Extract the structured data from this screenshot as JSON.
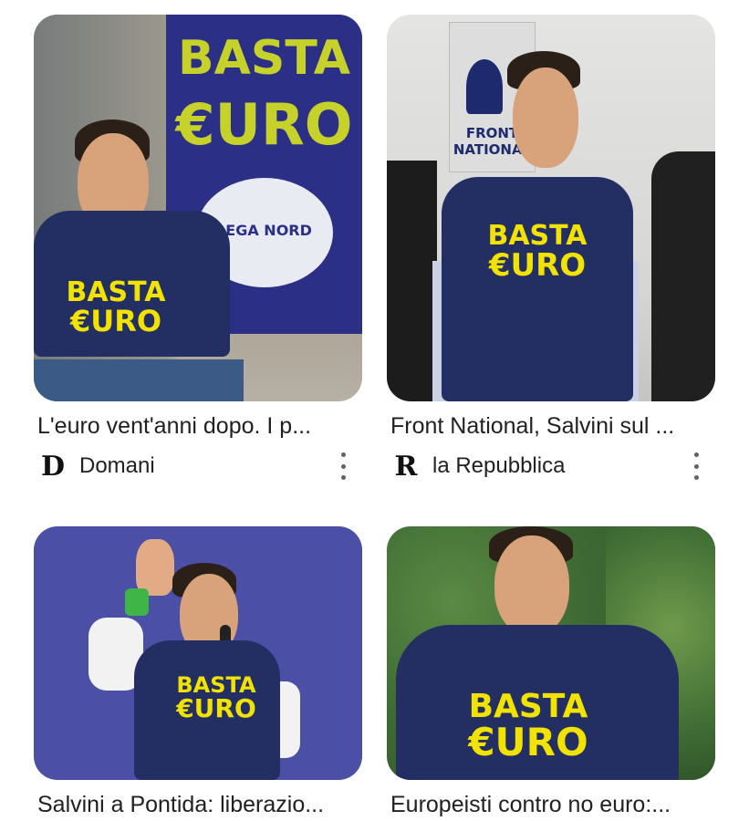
{
  "results": [
    {
      "caption": "L'euro vent'anni dopo. I p...",
      "source_logo": "D",
      "source": "Domani",
      "slogan_line1": "BASTA",
      "slogan_line2": "€URO",
      "poster_line1": "BASTA",
      "poster_line2": "€URO",
      "poster_badge": "LEGA NORD"
    },
    {
      "caption": "Front National, Salvini sul ...",
      "source_logo": "R",
      "source": "la Repubblica",
      "slogan_line1": "BASTA",
      "slogan_line2": "€URO",
      "poster_text": "FRONT NATIONAL"
    },
    {
      "caption": "Salvini a Pontida: liberazio...",
      "slogan_line1": "BASTA",
      "slogan_line2": "€URO"
    },
    {
      "caption": "Europeisti contro no euro:...",
      "slogan_line1": "BASTA",
      "slogan_line2": "€URO"
    }
  ],
  "colors": {
    "accent_yellow": "#f2e200",
    "shirt_navy": "#232f63",
    "poster_blue": "#2c2f86",
    "stage_blue": "#4b4fa6",
    "foliage_green": "#3f6a34"
  },
  "icons": {
    "more": "more-vert-icon"
  }
}
